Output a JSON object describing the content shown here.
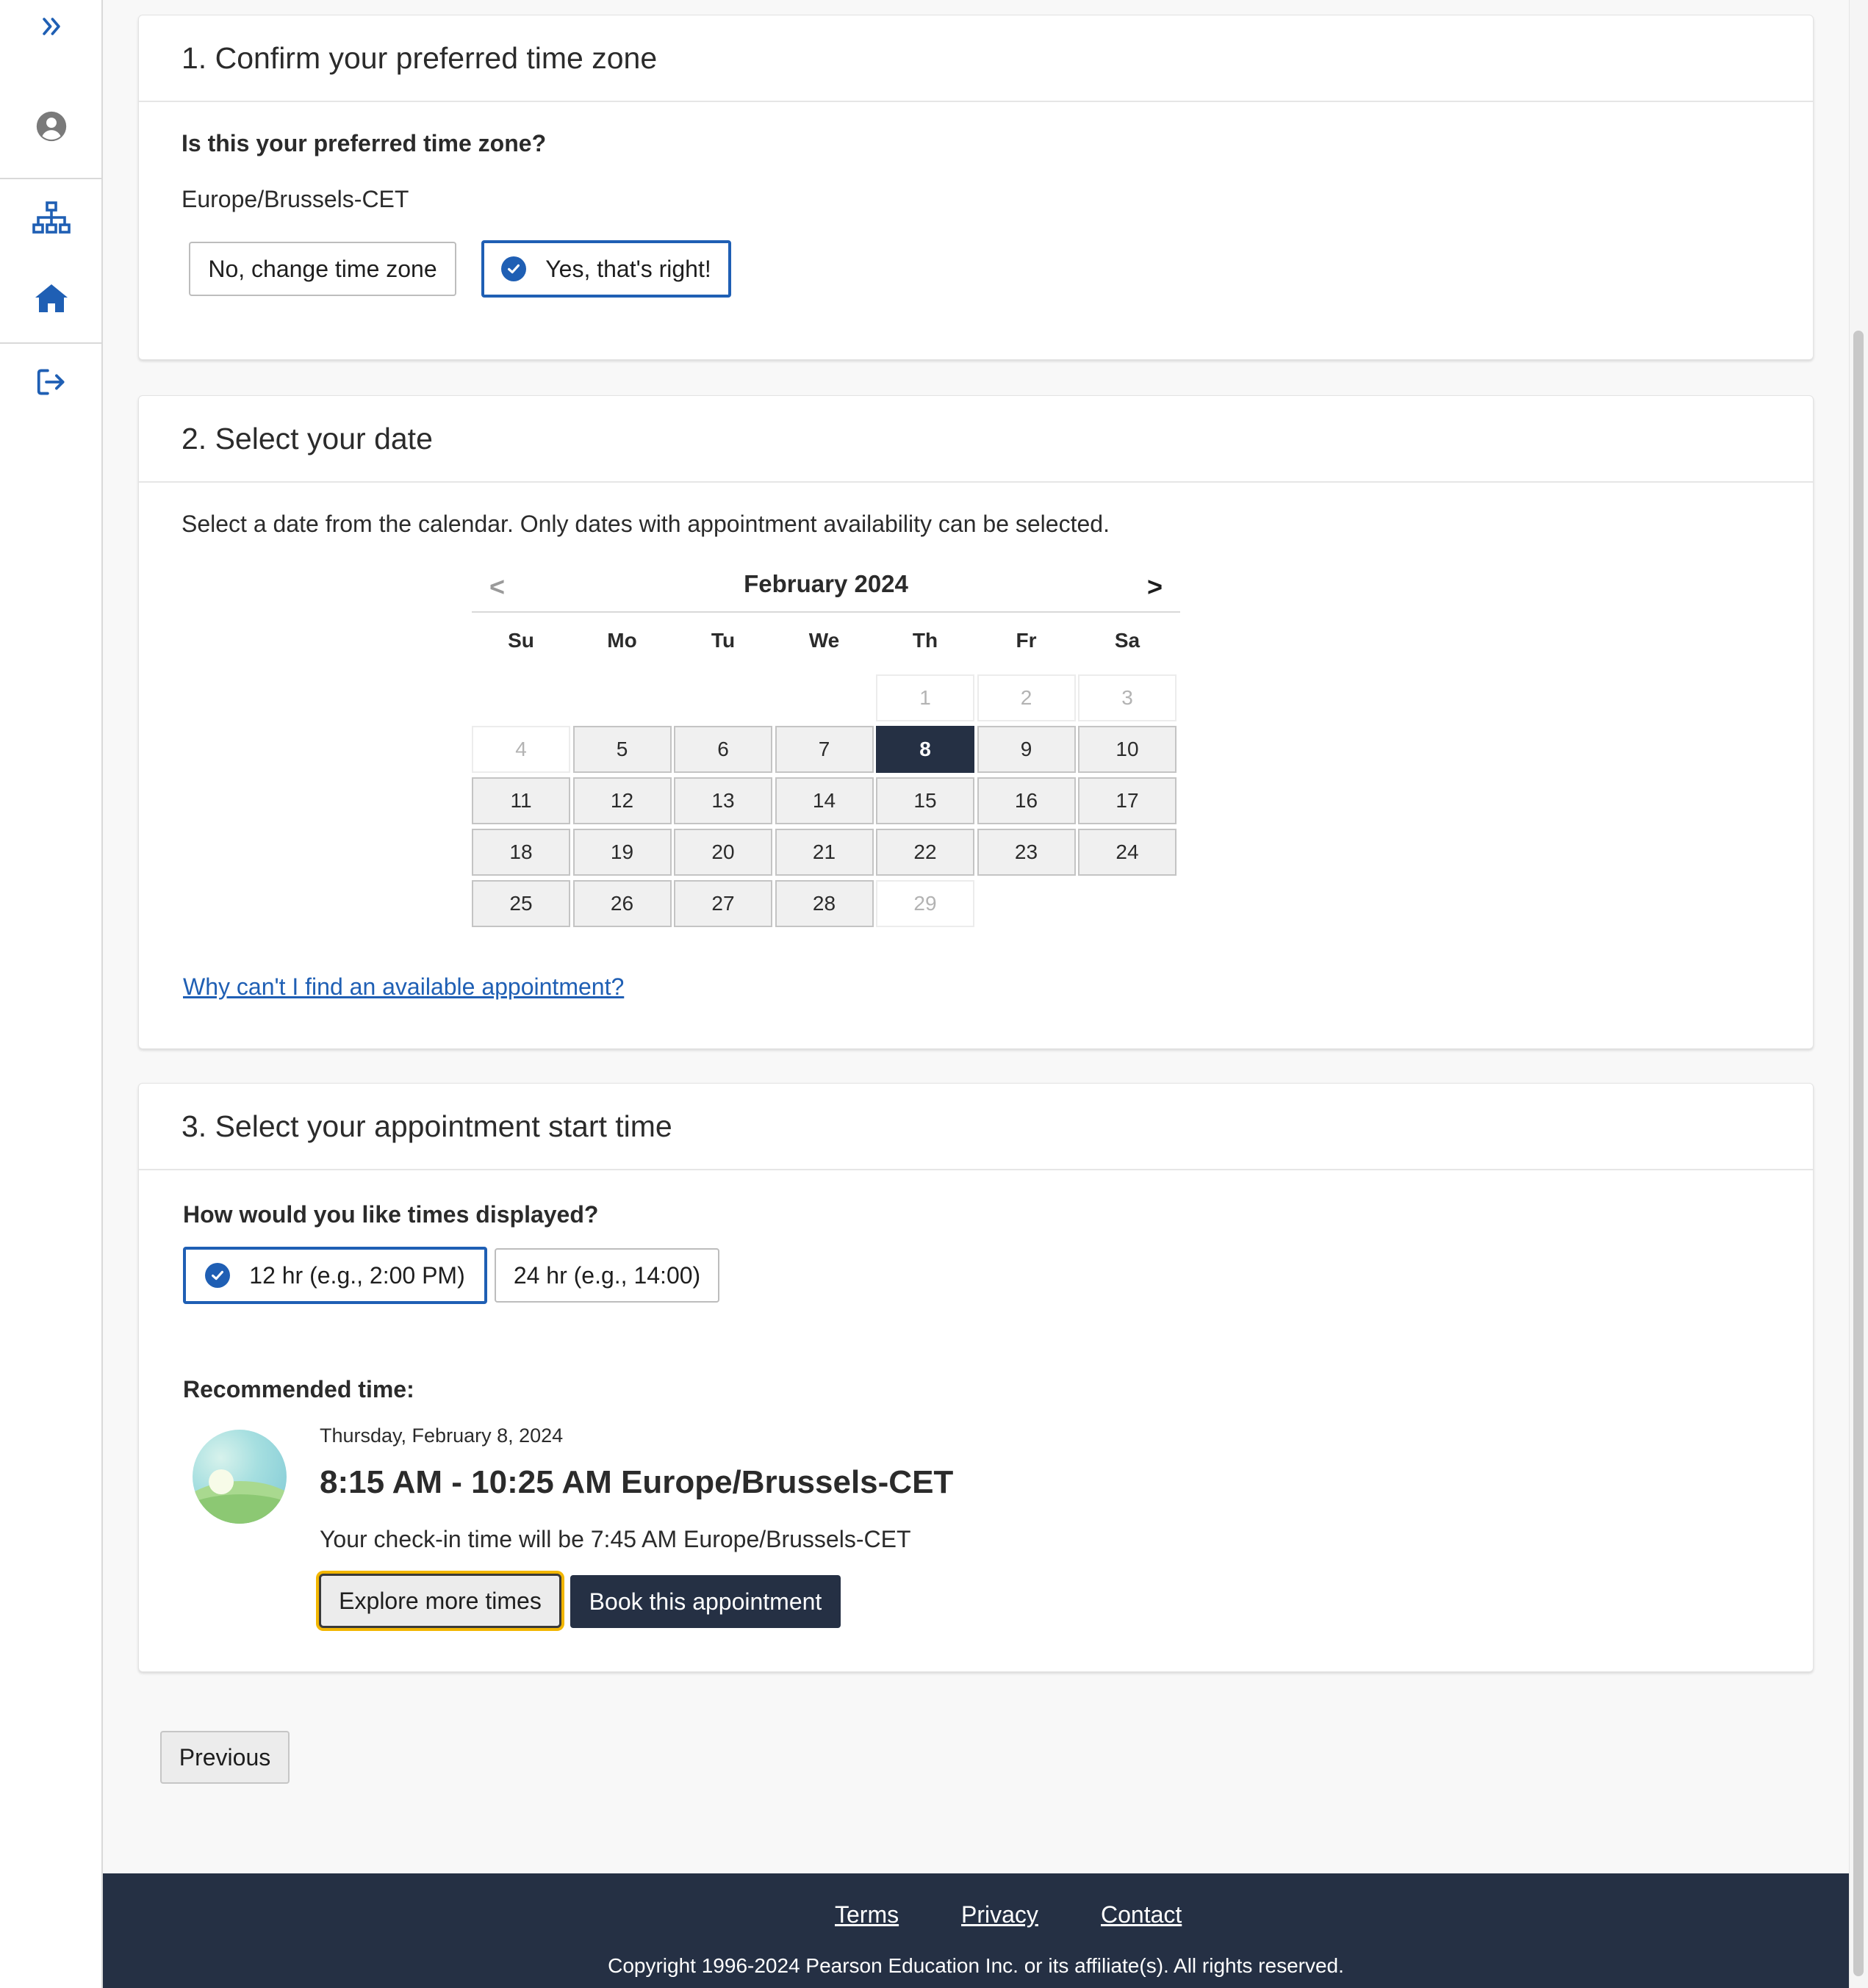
{
  "sidebar": {
    "items": [
      {
        "icon": "double-chevron-right-icon"
      },
      {
        "icon": "user-circle-icon"
      },
      {
        "icon": "sitemap-icon"
      },
      {
        "icon": "home-icon"
      },
      {
        "icon": "sign-out-icon"
      }
    ]
  },
  "section1": {
    "title": "1. Confirm your preferred time zone",
    "question": "Is this your preferred time zone?",
    "timezone": "Europe/Brussels-CET",
    "btn_change": "No, change time zone",
    "btn_confirm": "Yes, that's right!",
    "selected": "confirm"
  },
  "section2": {
    "title": "2. Select your date",
    "instructions": "Select a date from the calendar. Only dates with appointment availability can be selected.",
    "calendar": {
      "prev": "<",
      "next": ">",
      "month": "February 2024",
      "weekdays": [
        "Su",
        "Mo",
        "Tu",
        "We",
        "Th",
        "Fr",
        "Sa"
      ],
      "days": [
        {
          "d": "1",
          "state": "disabled"
        },
        {
          "d": "2",
          "state": "disabled"
        },
        {
          "d": "3",
          "state": "disabled"
        },
        {
          "d": "4",
          "state": "disabled"
        },
        {
          "d": "5",
          "state": "available"
        },
        {
          "d": "6",
          "state": "available"
        },
        {
          "d": "7",
          "state": "available"
        },
        {
          "d": "8",
          "state": "selected"
        },
        {
          "d": "9",
          "state": "available"
        },
        {
          "d": "10",
          "state": "available"
        },
        {
          "d": "11",
          "state": "available"
        },
        {
          "d": "12",
          "state": "available"
        },
        {
          "d": "13",
          "state": "available"
        },
        {
          "d": "14",
          "state": "available"
        },
        {
          "d": "15",
          "state": "available"
        },
        {
          "d": "16",
          "state": "available"
        },
        {
          "d": "17",
          "state": "available"
        },
        {
          "d": "18",
          "state": "available"
        },
        {
          "d": "19",
          "state": "available"
        },
        {
          "d": "20",
          "state": "available"
        },
        {
          "d": "21",
          "state": "available"
        },
        {
          "d": "22",
          "state": "available"
        },
        {
          "d": "23",
          "state": "available"
        },
        {
          "d": "24",
          "state": "available"
        },
        {
          "d": "25",
          "state": "available"
        },
        {
          "d": "26",
          "state": "available"
        },
        {
          "d": "27",
          "state": "available"
        },
        {
          "d": "28",
          "state": "available"
        },
        {
          "d": "29",
          "state": "disabled"
        }
      ]
    },
    "help_link": "Why can't I find an available appointment?"
  },
  "section3": {
    "title": "3. Select your appointment start time",
    "question": "How would you like times displayed?",
    "opt_12": "12 hr (e.g., 2:00 PM)",
    "opt_24": "24 hr (e.g., 14:00)",
    "selected_format": "12",
    "recommended_label": "Recommended time:",
    "rec_date": "Thursday, February 8, 2024",
    "rec_time": "8:15 AM - 10:25 AM Europe/Brussels-CET",
    "rec_checkin": "Your check-in time will be 7:45 AM Europe/Brussels-CET",
    "btn_explore": "Explore more times",
    "btn_book": "Book this appointment"
  },
  "nav": {
    "previous": "Previous"
  },
  "footer": {
    "terms": "Terms",
    "privacy": "Privacy",
    "contact": "Contact",
    "copyright": "Copyright 1996-2024 Pearson Education Inc. or its affiliate(s). All rights reserved."
  },
  "colors": {
    "accent": "#1f5fb4",
    "dark": "#253044",
    "focus": "#f2b600"
  }
}
